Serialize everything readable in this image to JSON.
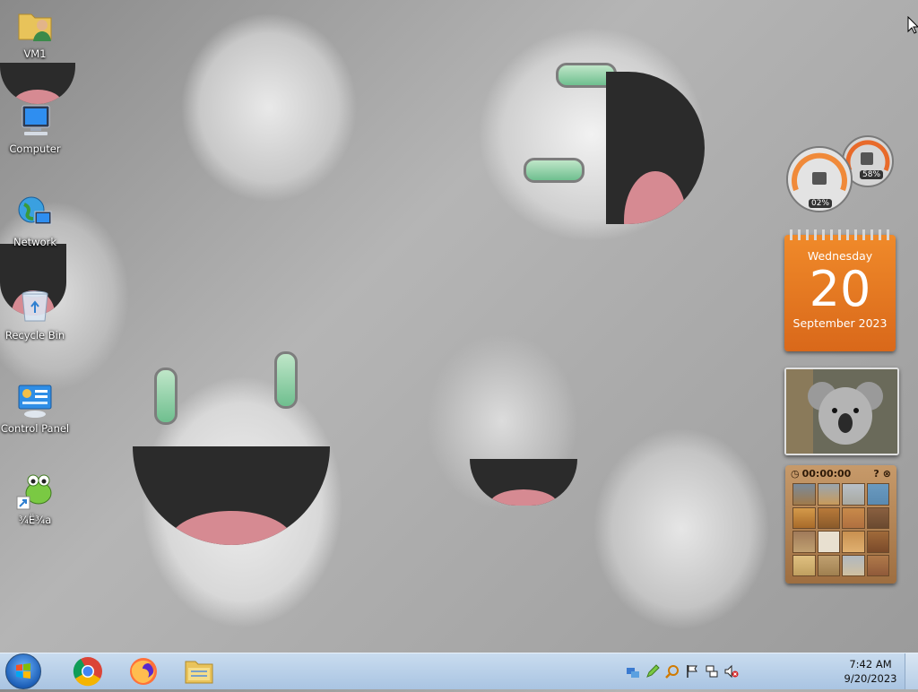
{
  "desktop": {
    "icons": [
      {
        "label": "VM1",
        "icon": "user-folder-icon"
      },
      {
        "label": "Computer",
        "icon": "computer-icon"
      },
      {
        "label": "Network",
        "icon": "network-globe-icon"
      },
      {
        "label": "Recycle Bin",
        "icon": "recycle-bin-icon"
      },
      {
        "label": "Control Panel",
        "icon": "control-panel-icon"
      },
      {
        "label": "¾Ë¾a",
        "icon": "frog-shortcut-icon"
      }
    ]
  },
  "gadgets": {
    "cpu_meter": {
      "cpu": "02%",
      "memory": "58%"
    },
    "calendar": {
      "weekday": "Wednesday",
      "day": "20",
      "month_year": "September 2023"
    },
    "slideshow": {
      "subject": "koala-photo"
    },
    "puzzle": {
      "timer": "00:00:00"
    }
  },
  "taskbar": {
    "pinned": [
      {
        "name": "chrome-taskbar-button",
        "icon": "chrome-icon"
      },
      {
        "name": "firefox-taskbar-button",
        "icon": "firefox-icon"
      },
      {
        "name": "explorer-taskbar-button",
        "icon": "folder-icon"
      }
    ],
    "tray_icons": [
      "network-settings-icon",
      "pencil-icon",
      "search-icon",
      "action-center-flag-icon",
      "network-icon",
      "volume-muted-icon"
    ],
    "clock": {
      "time": "7:42 AM",
      "date": "9/20/2023"
    }
  },
  "colors": {
    "taskbar": "#b9d1ea",
    "calendar_orange": "#e87a22",
    "start_orb": "#1d5fb7"
  }
}
